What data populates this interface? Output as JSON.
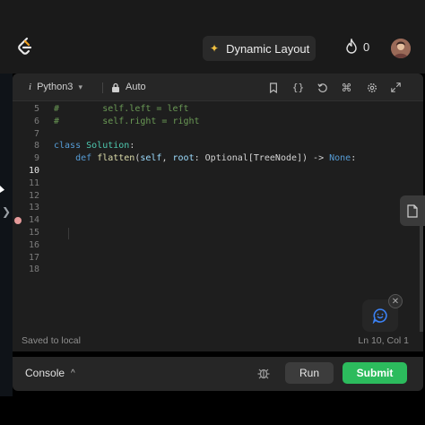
{
  "topbar": {
    "layout_label": "Dynamic Layout",
    "streak_count": "0"
  },
  "toolbar": {
    "language": "Python3",
    "mode": "Auto",
    "icons": [
      "bookmark-icon",
      "braces-icon",
      "reset-icon",
      "shortcut-icon",
      "settings-icon",
      "fullscreen-icon"
    ]
  },
  "code": {
    "lines": [
      {
        "n": "5",
        "parts": [
          {
            "t": "#",
            "c": "comment"
          },
          {
            "t": "        self.left = left",
            "c": "comment"
          }
        ]
      },
      {
        "n": "6",
        "parts": [
          {
            "t": "#",
            "c": "comment"
          },
          {
            "t": "        self.right = right",
            "c": "comment"
          }
        ]
      },
      {
        "n": "7",
        "parts": []
      },
      {
        "n": "8",
        "parts": [
          {
            "t": "class",
            "c": "kw"
          },
          {
            "t": " ",
            "c": "plain"
          },
          {
            "t": "Solution",
            "c": "cls"
          },
          {
            "t": ":",
            "c": "plain"
          }
        ]
      },
      {
        "n": "9",
        "parts": [
          {
            "t": "    ",
            "c": "plain"
          },
          {
            "t": "def",
            "c": "kw"
          },
          {
            "t": " ",
            "c": "plain"
          },
          {
            "t": "flatten",
            "c": "fn"
          },
          {
            "t": "(",
            "c": "plain"
          },
          {
            "t": "self",
            "c": "self"
          },
          {
            "t": ", ",
            "c": "plain"
          },
          {
            "t": "root",
            "c": "self"
          },
          {
            "t": ": Optional[TreeNode]) -> ",
            "c": "plain"
          },
          {
            "t": "None",
            "c": "kw"
          },
          {
            "t": ":",
            "c": "plain"
          }
        ]
      },
      {
        "n": "10",
        "parts": [],
        "current": true
      },
      {
        "n": "11",
        "parts": []
      },
      {
        "n": "12",
        "parts": []
      },
      {
        "n": "13",
        "parts": []
      },
      {
        "n": "14",
        "parts": []
      },
      {
        "n": "15",
        "parts": []
      },
      {
        "n": "16",
        "parts": []
      },
      {
        "n": "17",
        "parts": []
      },
      {
        "n": "18",
        "parts": []
      }
    ]
  },
  "status": {
    "saved": "Saved to local",
    "position": "Ln 10, Col 1"
  },
  "console": {
    "label": "Console",
    "run": "Run",
    "submit": "Submit"
  },
  "colors": {
    "submit": "#2cbb5d",
    "accent_spark": "#f0c040",
    "chat_icon": "#3b82f6"
  }
}
